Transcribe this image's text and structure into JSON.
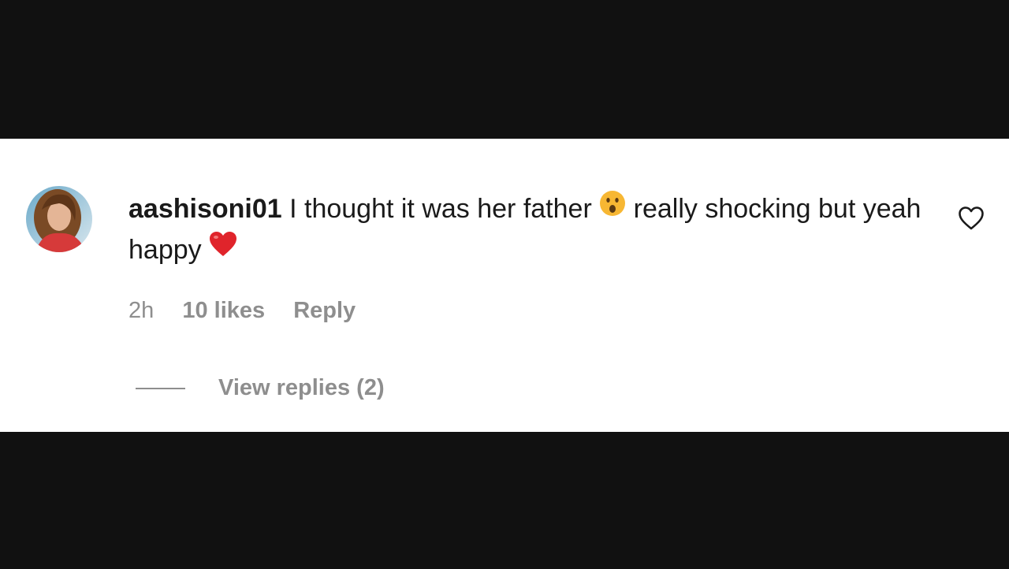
{
  "comment": {
    "username": "aashisoni01",
    "text_part1": " I thought it was her father ",
    "emoji1": "surprised-face-emoji",
    "text_part2": " really shocking but yeah happy ",
    "emoji2": "red-heart-emoji",
    "time": "2h",
    "likes": "10 likes",
    "reply_label": "Reply",
    "view_replies_label": "View replies (2)"
  },
  "colors": {
    "background_bars": "#111111",
    "panel": "#ffffff",
    "text": "#1a1a1a",
    "muted": "#8e8e8e",
    "heart_emoji": "#e0242b",
    "surprised_emoji": "#f7b733"
  },
  "icons": {
    "like": "heart-outline-icon"
  }
}
